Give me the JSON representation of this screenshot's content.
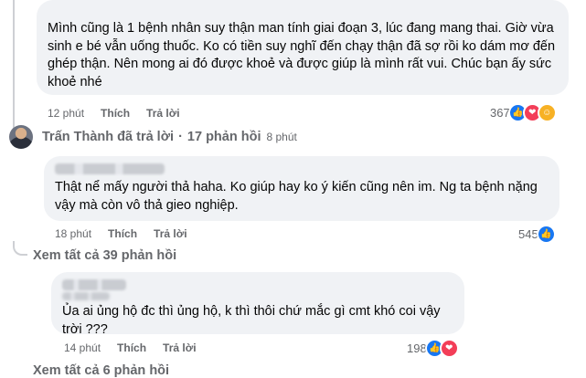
{
  "comments": [
    {
      "text": "Mình cũng là 1 bệnh nhân suy thận man tính giai đoạn 3, lúc đang mang thai. Giờ vừa sinh e bé vẫn uống thuốc. Ko có tiền suy nghĩ đến chạy thận đã sợ rồi ko dám mơ đến ghép thận. Nên mong ai đó được khoẻ và được giúp là mình rất vui. Chúc bạn ấy sức khoẻ nhé",
      "time": "12 phút",
      "like_label": "Thích",
      "reply_label": "Trả lời",
      "reaction_count": "367",
      "reactions": [
        "like-icon",
        "love-icon",
        "care-icon"
      ]
    },
    {
      "text": "Thật nể mấy người thả haha. Ko giúp hay ko ý kiến cũng nên im. Ng ta bệnh nặng vậy mà còn vô thả gieo nghiệp.",
      "time": "18 phút",
      "like_label": "Thích",
      "reply_label": "Trả lời",
      "reaction_count": "545",
      "reactions": [
        "like-icon"
      ]
    },
    {
      "author_partial": "Yêu Ngọc",
      "text": "Ủa ai ủng hộ đc thì ủng hộ, k thì thôi chứ mắc gì cmt khó coi vậy trời ???",
      "time": "14 phút",
      "like_label": "Thích",
      "reply_label": "Trả lời",
      "reaction_count": "198",
      "reactions": [
        "like-icon",
        "love-icon"
      ]
    }
  ],
  "replied": {
    "name_text": "Trấn Thành đã trả lời",
    "separator": "·",
    "replies_text": "17 phản hồi",
    "time": "8 phút"
  },
  "view_more_1": "Xem tất cả 39 phản hồi",
  "view_more_2": "Xem tất cả 6 phản hồi",
  "colors": {
    "like": "#1877f2",
    "love": "#f33e58",
    "care": "#f7b125",
    "meta": "#65676b",
    "bubble": "#f0f2f5"
  }
}
